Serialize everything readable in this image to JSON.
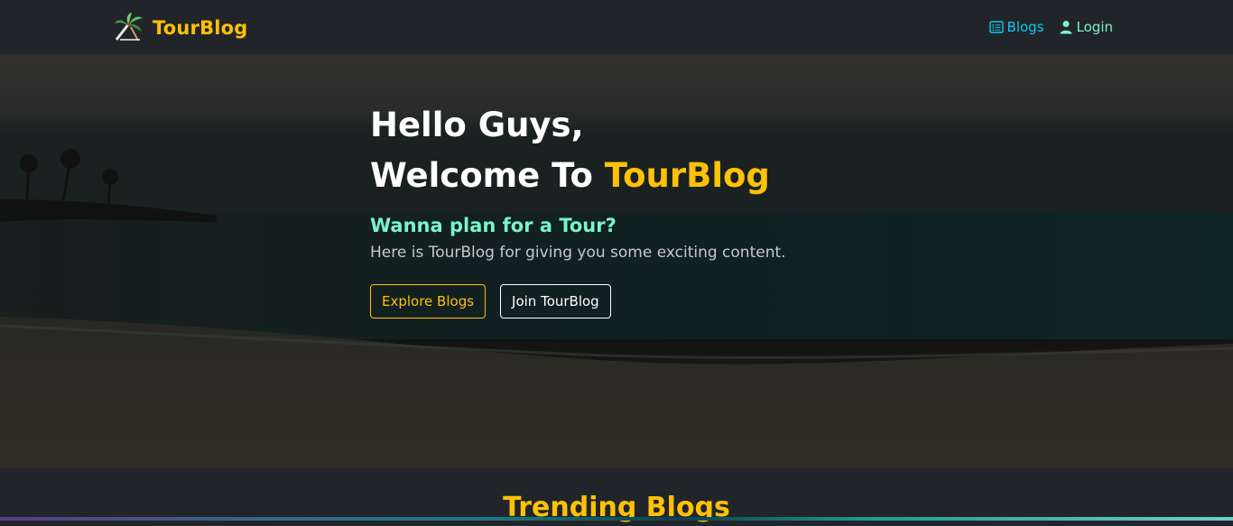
{
  "navbar": {
    "brand": "TourBlog",
    "links": [
      {
        "label": "Blogs",
        "icon": "list-icon"
      },
      {
        "label": "Login",
        "icon": "user-icon"
      }
    ]
  },
  "hero": {
    "greeting": "Hello Guys,",
    "welcome_prefix": "Welcome To",
    "welcome_brand": "TourBlog",
    "subheading": "Wanna plan for a Tour?",
    "description": "Here is TourBlog for giving you some exciting content.",
    "buttons": {
      "explore": "Explore Blogs",
      "join": "Join TourBlog"
    }
  },
  "trending": {
    "title": "Trending Blogs"
  },
  "colors": {
    "accent": "#ffc107",
    "mint": "#7af4c8",
    "cyan": "#0dcaf0",
    "dark": "#212529"
  }
}
